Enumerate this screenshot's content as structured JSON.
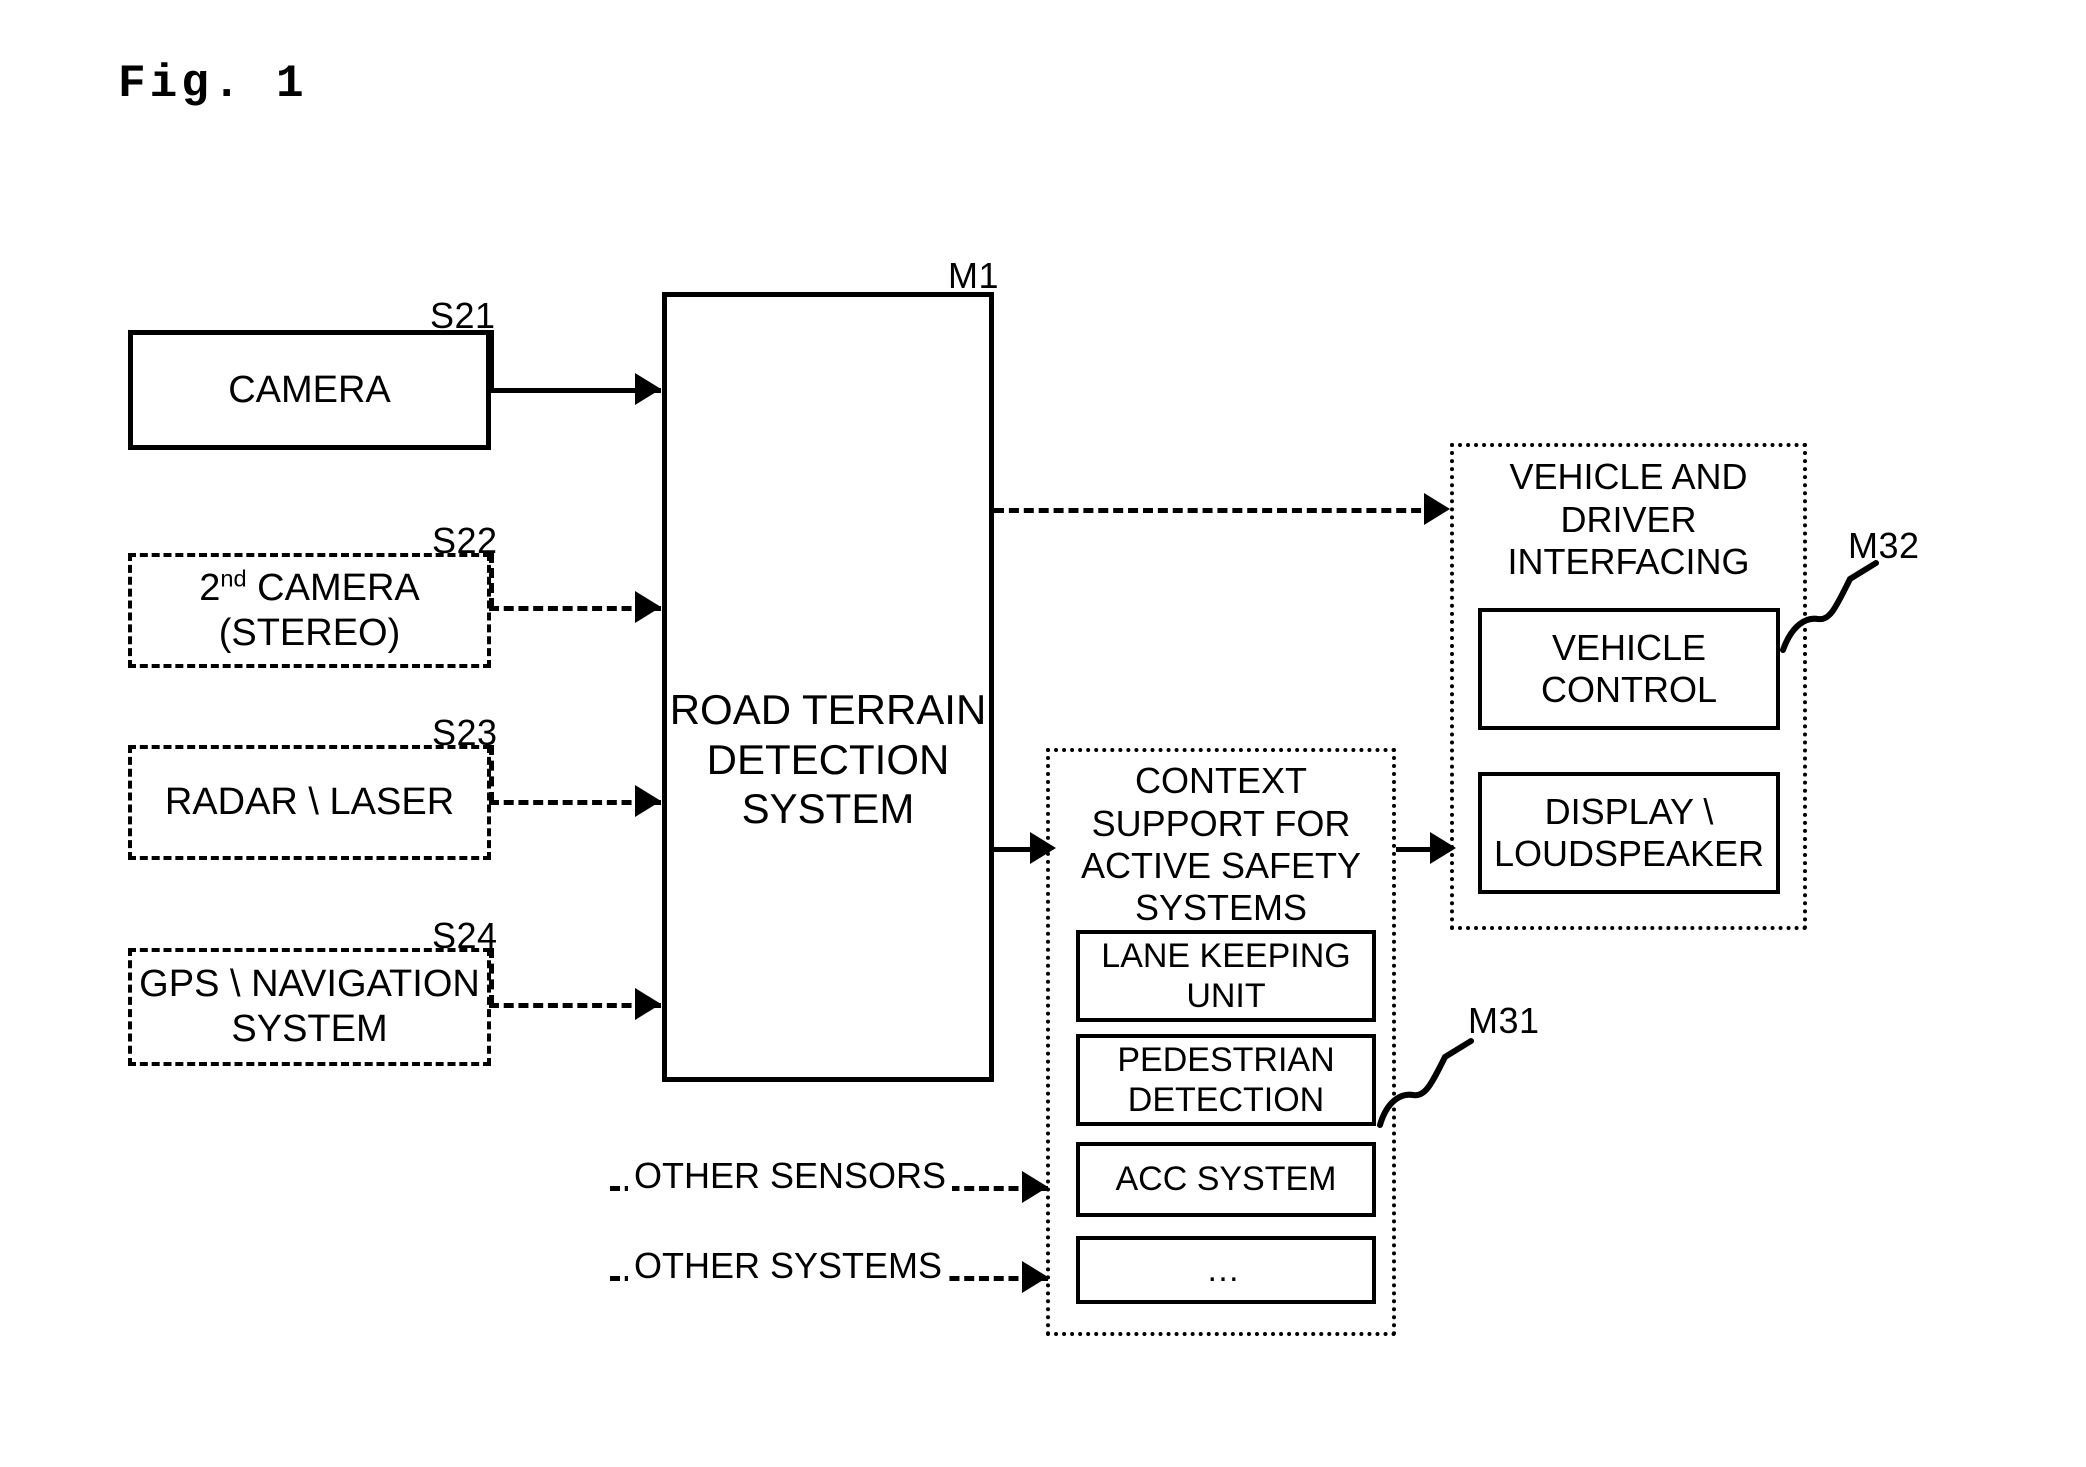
{
  "figure": {
    "title": "Fig. 1",
    "domain_description": "Patent block diagram of a road terrain detection system"
  },
  "sensors": [
    {
      "ref": "S21",
      "label": "CAMERA",
      "border": "solid",
      "connector": "solid"
    },
    {
      "ref": "S22",
      "label_line1": "2",
      "label_sup": "nd",
      "label_line1_rest": " CAMERA",
      "label_line2": "(STEREO)",
      "border": "dashed",
      "connector": "dashed"
    },
    {
      "ref": "S23",
      "label": "RADAR \\ LASER",
      "border": "dashed",
      "connector": "dashed"
    },
    {
      "ref": "S24",
      "label_line1": "GPS \\ NAVIGATION",
      "label_line2": "SYSTEM",
      "border": "dashed",
      "connector": "dashed"
    }
  ],
  "main_unit": {
    "ref": "M1",
    "label_line1": "ROAD TERRAIN",
    "label_line2": "DETECTION",
    "label_line3": "SYSTEM",
    "border": "solid"
  },
  "context_support": {
    "ref": "M31",
    "title_line1": "CONTEXT",
    "title_line2": "SUPPORT FOR",
    "title_line3": "ACTIVE SAFETY",
    "title_line4": "SYSTEMS",
    "border": "dotted",
    "items": [
      {
        "label_line1": "LANE KEEPING",
        "label_line2": "UNIT"
      },
      {
        "label_line1": "PEDESTRIAN",
        "label_line2": "DETECTION"
      },
      {
        "label_line1": "ACC SYSTEM",
        "label_line2": ""
      },
      {
        "label_line1": "…",
        "label_line2": ""
      }
    ]
  },
  "vehicle_driver_interfacing": {
    "ref": "M32",
    "title_line1": "VEHICLE AND",
    "title_line2": "DRIVER",
    "title_line3": "INTERFACING",
    "border": "dotted",
    "items": [
      {
        "label_line1": "VEHICLE",
        "label_line2": "CONTROL"
      },
      {
        "label_line1": "DISPLAY \\",
        "label_line2": "LOUDSPEAKER"
      }
    ]
  },
  "other_inputs": [
    {
      "label": "OTHER SENSORS",
      "connector": "dashed"
    },
    {
      "label": "OTHER SYSTEMS",
      "connector": "dashed"
    }
  ],
  "colors": {
    "stroke": "#000000",
    "background": "#ffffff"
  }
}
